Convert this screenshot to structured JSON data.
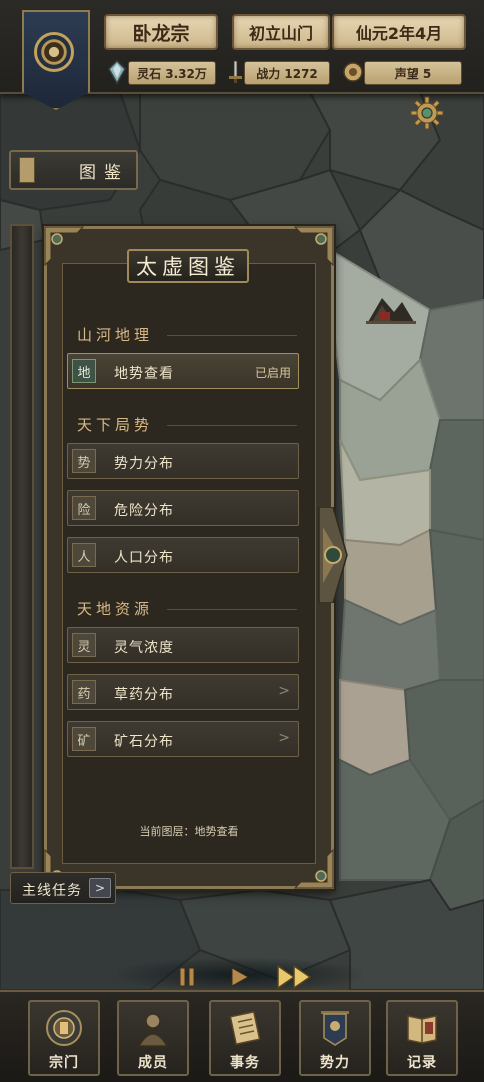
{
  "header": {
    "sect_name": "卧龙宗",
    "sect_stage": "初立山门",
    "date": "仙元2年4月",
    "stats": {
      "spirit_stones": "灵石 3.32万",
      "power": "战力 1272",
      "reputation": "声望 5"
    }
  },
  "atlas_tab": {
    "label": "图鉴"
  },
  "panel": {
    "title": "太虚图鉴",
    "sections": [
      {
        "title": "山河地理"
      },
      {
        "title": "天下局势"
      },
      {
        "title": "天地资源"
      }
    ],
    "items": [
      {
        "icon_char": "地",
        "label": "地势查看",
        "status": "已启用"
      },
      {
        "icon_char": "势",
        "label": "势力分布"
      },
      {
        "icon_char": "险",
        "label": "危险分布"
      },
      {
        "icon_char": "人",
        "label": "人口分布"
      },
      {
        "icon_char": "灵",
        "label": "灵气浓度"
      },
      {
        "icon_char": "药",
        "label": "草药分布",
        "chevron": ">"
      },
      {
        "icon_char": "矿",
        "label": "矿石分布",
        "chevron": ">"
      }
    ],
    "current_layer": "当前图层：地势查看"
  },
  "quest": {
    "label": "主线任务",
    "arrow": ">"
  },
  "time_controls": {
    "icons": [
      "pause-icon",
      "play-icon",
      "fast-forward-icon"
    ]
  },
  "nav": [
    {
      "label": "宗门",
      "icon": "sect-icon"
    },
    {
      "label": "成员",
      "icon": "member-icon"
    },
    {
      "label": "事务",
      "icon": "scroll-icon"
    },
    {
      "label": "势力",
      "icon": "faction-banner-icon"
    },
    {
      "label": "记录",
      "icon": "book-icon"
    }
  ],
  "colors": {
    "accent_gold": "#c2a25c",
    "panel_bg": "#2c2820",
    "section_text": "#d9b884",
    "map_dark": "#3b3f3c",
    "map_light": "#b7b9a7"
  }
}
